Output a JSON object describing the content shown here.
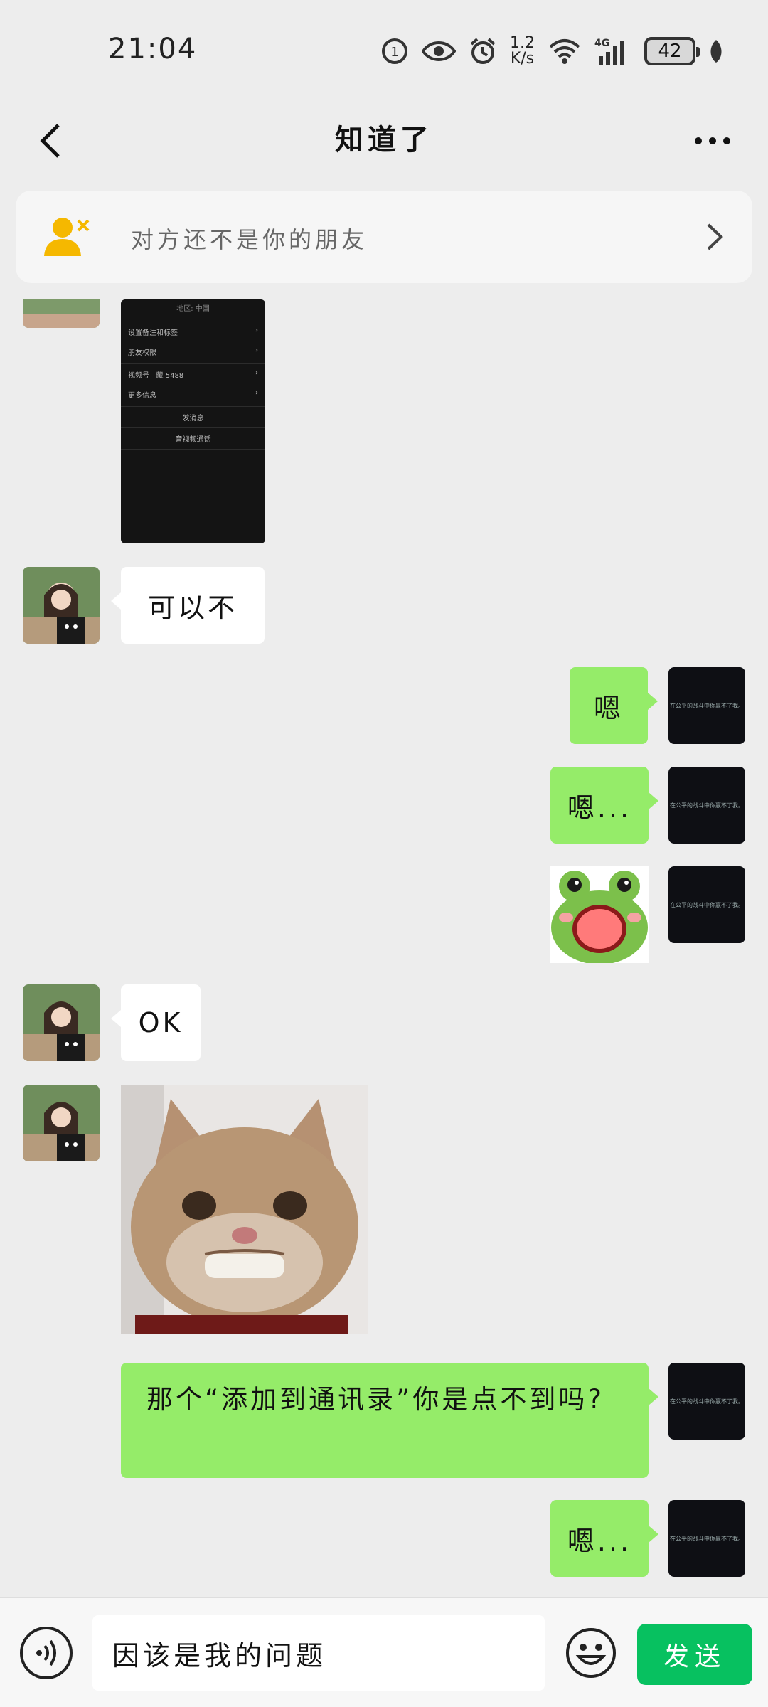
{
  "status_bar": {
    "time": "21:04",
    "speed_value": "1.2",
    "speed_unit": "K/s",
    "network": "4G",
    "battery": "42"
  },
  "header": {
    "title": "知道了",
    "back_icon": "chevron-left-icon",
    "more_icon": "more-horizontal-icon"
  },
  "notice": {
    "text": "对方还不是你的朋友",
    "icon": "user-remove-icon",
    "accent": "#f5b800"
  },
  "screenshot_message": {
    "rows": [
      "设置备注和标签",
      "朋友权限",
      "视频号",
      "更多信息"
    ],
    "video_value": "藏 5488",
    "top_text": "地区: 中国",
    "send_message": "发消息",
    "video_call": "音视频通话"
  },
  "messages": [
    {
      "side": "left",
      "text": "可以不"
    },
    {
      "side": "right",
      "text": "嗯"
    },
    {
      "side": "right",
      "text": "嗯..."
    },
    {
      "side": "right",
      "type": "sticker",
      "sticker": "frog-sticker"
    },
    {
      "side": "left",
      "text": "OK"
    },
    {
      "side": "left",
      "type": "image",
      "image": "smiling-cat-image"
    },
    {
      "side": "right",
      "text": "那个“添加到通讯录”你是点不到吗?"
    },
    {
      "side": "right",
      "text": "嗯..."
    }
  ],
  "my_avatar_text": "在公平的战斗中你赢不了我。",
  "input_bar": {
    "input_value": "因该是我的问题",
    "send_label": "发送",
    "send_color": "#07c160",
    "voice_icon": "voice-icon",
    "emoji_icon": "emoji-icon"
  },
  "colors": {
    "bubble_right": "#95ec69",
    "bubble_left": "#ffffff",
    "background": "#ededed"
  }
}
